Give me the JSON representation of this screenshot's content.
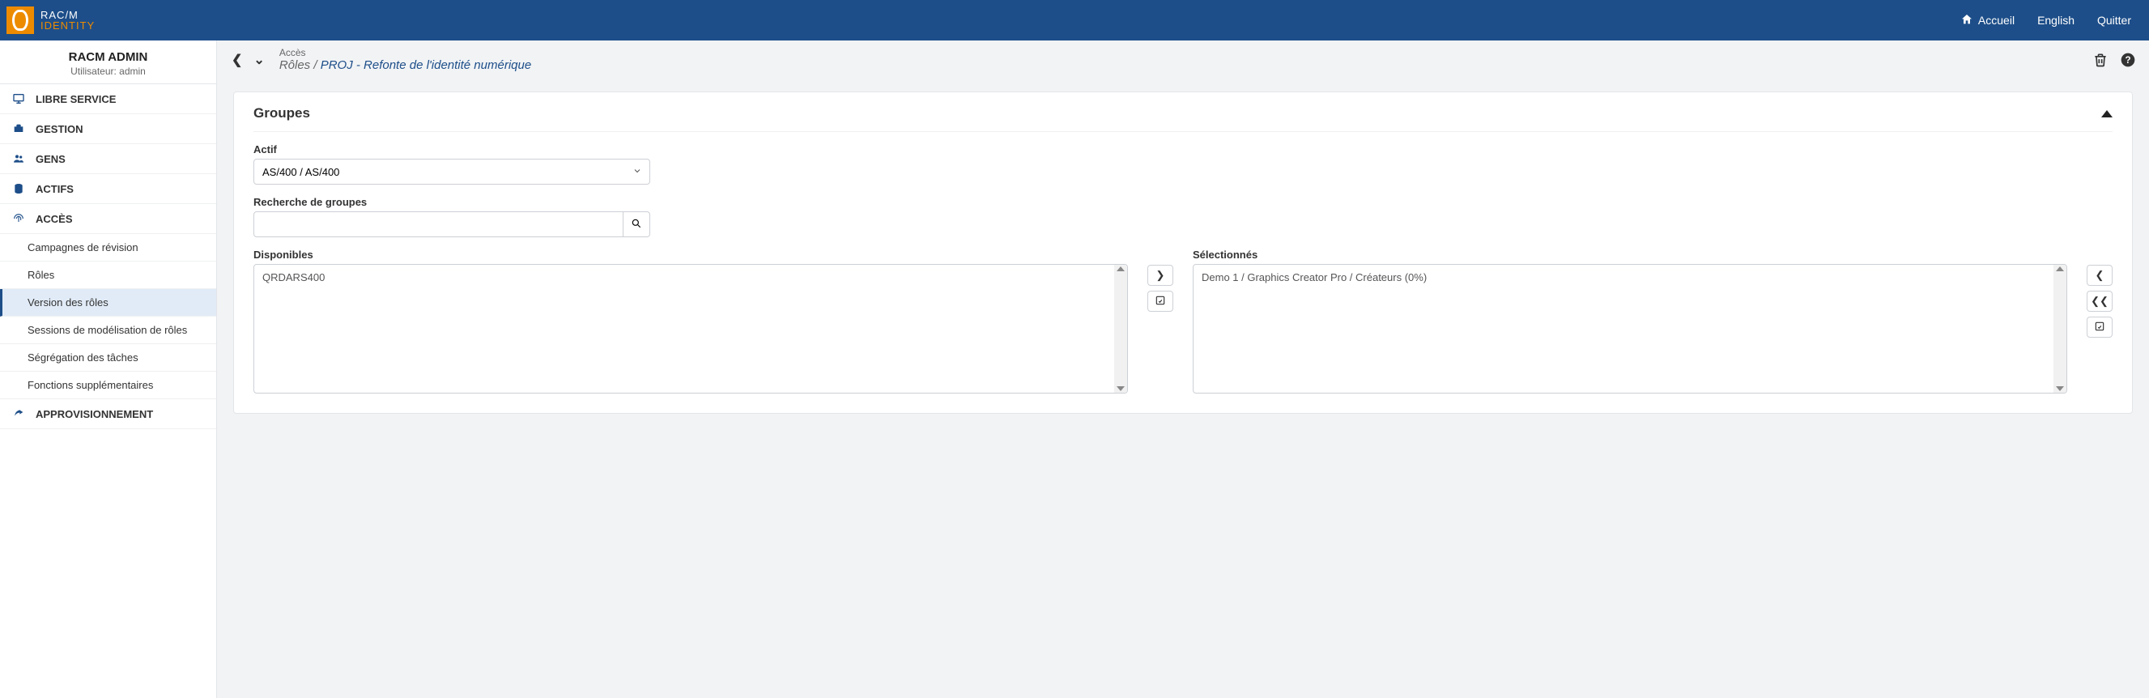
{
  "brand": {
    "line1": "RAC/M",
    "line2": "IDENTITY"
  },
  "topbar": {
    "home": "Accueil",
    "language": "English",
    "quit": "Quitter"
  },
  "tenant": {
    "name": "RACM ADMIN",
    "user_label": "Utilisateur: admin"
  },
  "nav": {
    "libre_service": "LIBRE SERVICE",
    "gestion": "GESTION",
    "gens": "GENS",
    "actifs": "ACTIFS",
    "acces": "ACCÈS",
    "approvisionnement": "APPROVISIONNEMENT",
    "sub": {
      "campagnes": "Campagnes de révision",
      "roles": "Rôles",
      "version_roles": "Version des rôles",
      "sessions_modelisation": "Sessions de modélisation de rôles",
      "segregation": "Ségrégation des tâches",
      "fonctions_supp": "Fonctions supplémentaires"
    }
  },
  "breadcrumb": {
    "context": "Accès",
    "root": "Rôles",
    "sep": " / ",
    "current": "PROJ - Refonte de l'identité numérique"
  },
  "panel": {
    "title": "Groupes",
    "actif_label": "Actif",
    "actif_value": "AS/400 / AS/400",
    "search_label": "Recherche de groupes",
    "disponibles_label": "Disponibles",
    "selectionnes_label": "Sélectionnés",
    "available_items": [
      "QRDARS400"
    ],
    "selected_items": [
      "Demo 1 / Graphics Creator Pro / Créateurs (0%)"
    ]
  }
}
